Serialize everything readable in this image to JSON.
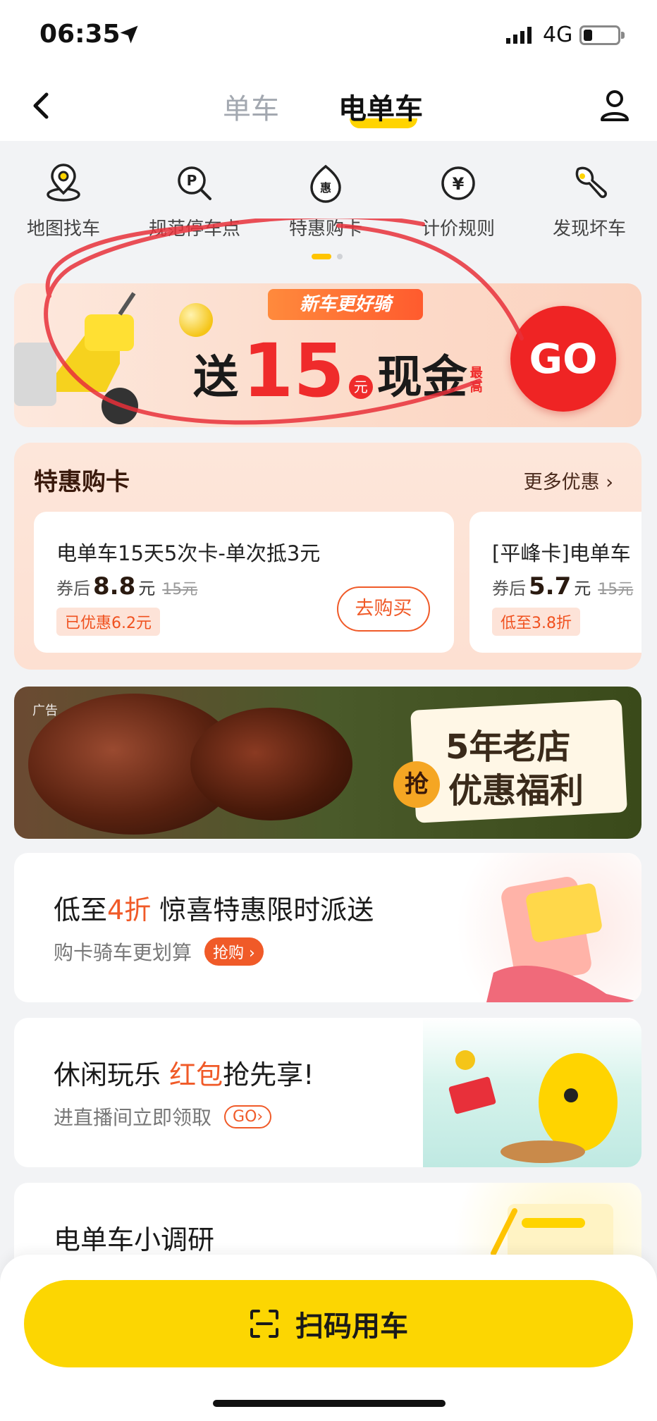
{
  "status": {
    "time": "06:35",
    "network": "4G"
  },
  "nav": {
    "tab_bike": "单车",
    "tab_ebike": "电单车"
  },
  "quick_menu": [
    {
      "label": "地图找车",
      "icon": "map-pin-icon"
    },
    {
      "label": "规范停车点",
      "icon": "parking-search-icon"
    },
    {
      "label": "特惠购卡",
      "icon": "discount-icon"
    },
    {
      "label": "计价规则",
      "icon": "yen-icon"
    },
    {
      "label": "发现坏车",
      "icon": "wrench-icon"
    }
  ],
  "promo_banner": {
    "tag": "新车更好骑",
    "pre": "送",
    "amount": "15",
    "unit": "元",
    "post": "现金",
    "max": "最高",
    "go": "GO"
  },
  "card_section": {
    "title": "特惠购卡",
    "more": "更多优惠 ›",
    "cards": [
      {
        "name": "电单车15天5次卡-单次抵3元",
        "price_label": "券后",
        "price": "8.8",
        "price_unit": "元",
        "original": "15元",
        "badge": "已优惠6.2元",
        "buy": "去购买"
      },
      {
        "name": "[平峰卡]电单车",
        "price_label": "券后",
        "price": "5.7",
        "price_unit": "元",
        "original": "15元",
        "badge": "低至3.8折"
      }
    ]
  },
  "ad": {
    "label": "广告",
    "line1": "5年老店",
    "line2": "优惠福利",
    "grab": "抢"
  },
  "promo_cards": [
    {
      "title_a": "低至",
      "title_red": "4折",
      "title_b": " 惊喜特惠限时派送",
      "sub": "购卡骑车更划算",
      "pill": "抢购 ›"
    },
    {
      "title_a": "休闲玩乐 ",
      "title_red": "红包",
      "title_b": "抢先享!",
      "sub": "进直播间立即领取",
      "pill": "GO›"
    },
    {
      "title_a": "电单车小调研",
      "title_red": "",
      "title_b": "",
      "sub": "",
      "pill": ""
    }
  ],
  "scan_button": "扫码用车",
  "colors": {
    "accent": "#fcd602",
    "red": "#ef2424",
    "orange": "#f05a28"
  }
}
